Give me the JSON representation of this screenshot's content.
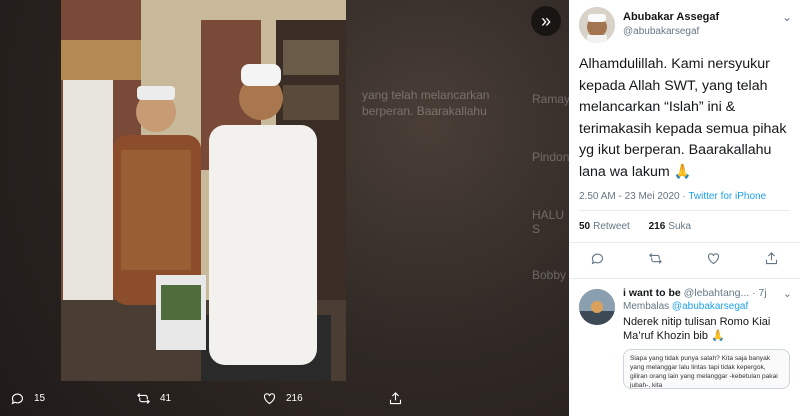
{
  "media": {
    "ghost_texts": [
      "yang telah melancarkan",
      "berperan. Baarakallahu",
      "Ramayan",
      "Pindono",
      "HALU S",
      "Bobby"
    ],
    "actions": [
      {
        "name": "reply",
        "count": "15"
      },
      {
        "name": "retweet",
        "count": "41"
      },
      {
        "name": "like",
        "count": "216"
      },
      {
        "name": "share",
        "count": ""
      }
    ]
  },
  "tweet": {
    "author_name": "Abubakar Assegaf",
    "author_handle": "@abubakarsegaf",
    "text": "Alhamdulillah. Kami nersyukur kepada Allah SWT, yang telah melancarkan “Islah” ini & terimakasih kepada semua pihak yg ikut berperan. Baarakallahu lana wa lakum 🙏",
    "time": "2.50 AM - 23 Mei 2020",
    "source": "Twitter for iPhone",
    "retweets_count": "50",
    "retweets_label": "Retweet",
    "likes_count": "216",
    "likes_label": "Suka"
  },
  "reply": {
    "name": "i want to be",
    "handle": "@lebahtang...",
    "time": "· 7j",
    "replying_prefix": "Membalas",
    "replying_to": "@abubakarsegaf",
    "text": "Nderek nitip tulisan Romo Kiai Ma’ruf Khozin bib 🙏",
    "quote_text": "Siapa yang tidak punya salah? Kita saja banyak yang melanggar lalu lintas tapi tidak kepergok, giliran orang lain yang melanggar -kebetulan pakai jubah-, kita"
  },
  "colors": {
    "link": "#1da1f2",
    "muted": "#657786",
    "text": "#14171a"
  }
}
